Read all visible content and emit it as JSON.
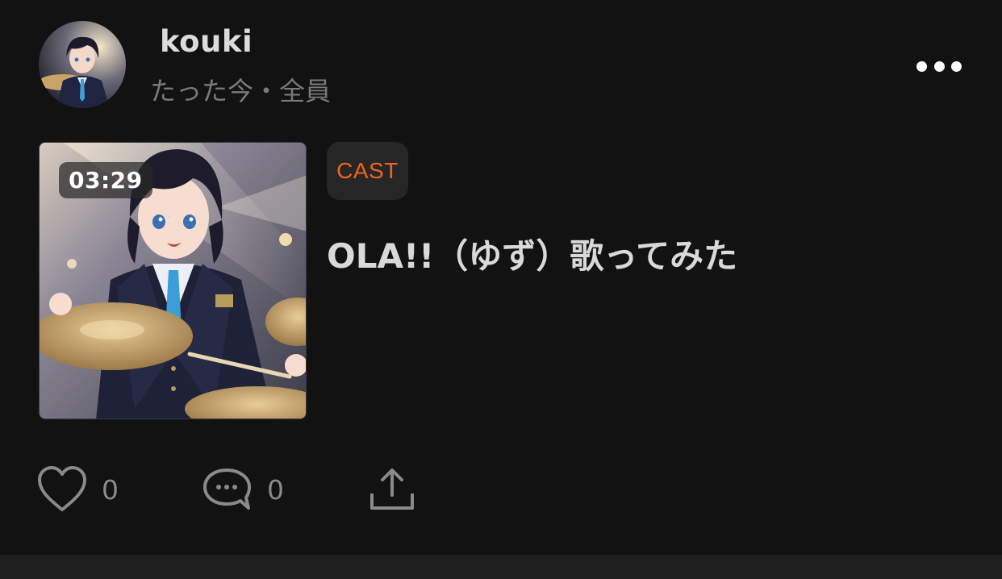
{
  "post": {
    "author": {
      "name": "kouki",
      "meta": "たった今・全員",
      "avatar_icon": "avatar-image"
    },
    "more_icon": "more-horizontal-icon",
    "media": {
      "duration": "03:29",
      "thumbnail": "anime-drummer-illustration"
    },
    "tag": "CAST",
    "title": "OLA!!（ゆず）歌ってみた",
    "actions": {
      "likes": "0",
      "comments": "0",
      "like_icon": "heart-icon",
      "comment_icon": "comment-bubble-icon",
      "share_icon": "share-upload-icon"
    },
    "colors": {
      "background": "#121212",
      "tag_text": "#f0641e",
      "tag_bg": "#262626",
      "meta_text": "#7a7a7a",
      "title_text": "#d9d9d9"
    }
  }
}
